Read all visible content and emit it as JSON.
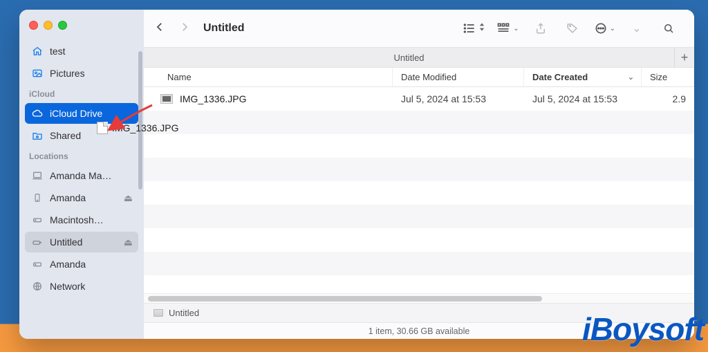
{
  "window": {
    "title": "Untitled"
  },
  "sidebar": {
    "groups": [
      {
        "items": [
          {
            "icon": "house-icon",
            "label": "test"
          },
          {
            "icon": "pictures-icon",
            "label": "Pictures"
          }
        ]
      },
      {
        "label": "iCloud",
        "items": [
          {
            "icon": "cloud-icon",
            "label": "iCloud Drive",
            "selected": true
          },
          {
            "icon": "shared-folder-icon",
            "label": "Shared"
          }
        ]
      },
      {
        "label": "Locations",
        "items": [
          {
            "icon": "laptop-icon",
            "label": "Amanda Ma…"
          },
          {
            "icon": "phone-icon",
            "label": "Amanda",
            "eject": true
          },
          {
            "icon": "disk-icon",
            "label": "Macintosh…"
          },
          {
            "icon": "external-disk-icon",
            "label": "Untitled",
            "eject": true,
            "activeHighlight": true
          },
          {
            "icon": "disk-icon",
            "label": "Amanda"
          },
          {
            "icon": "globe-icon",
            "label": "Network"
          }
        ]
      }
    ]
  },
  "tabs": {
    "items": [
      "Untitled"
    ],
    "plus": "+"
  },
  "columns": {
    "name": "Name",
    "date_modified": "Date Modified",
    "date_created": "Date Created",
    "size": "Size"
  },
  "rows": [
    {
      "name": "IMG_1336.JPG",
      "date_modified": "Jul 5, 2024 at 15:53",
      "date_created": "Jul 5, 2024 at 15:53",
      "size": "2.9"
    }
  ],
  "drag_ghost": {
    "label": "IMG_1336.JPG"
  },
  "pathbar": {
    "label": "Untitled"
  },
  "statusbar": {
    "text": "1 item, 30.66 GB available"
  },
  "watermark": {
    "text": "iBoysoft"
  }
}
